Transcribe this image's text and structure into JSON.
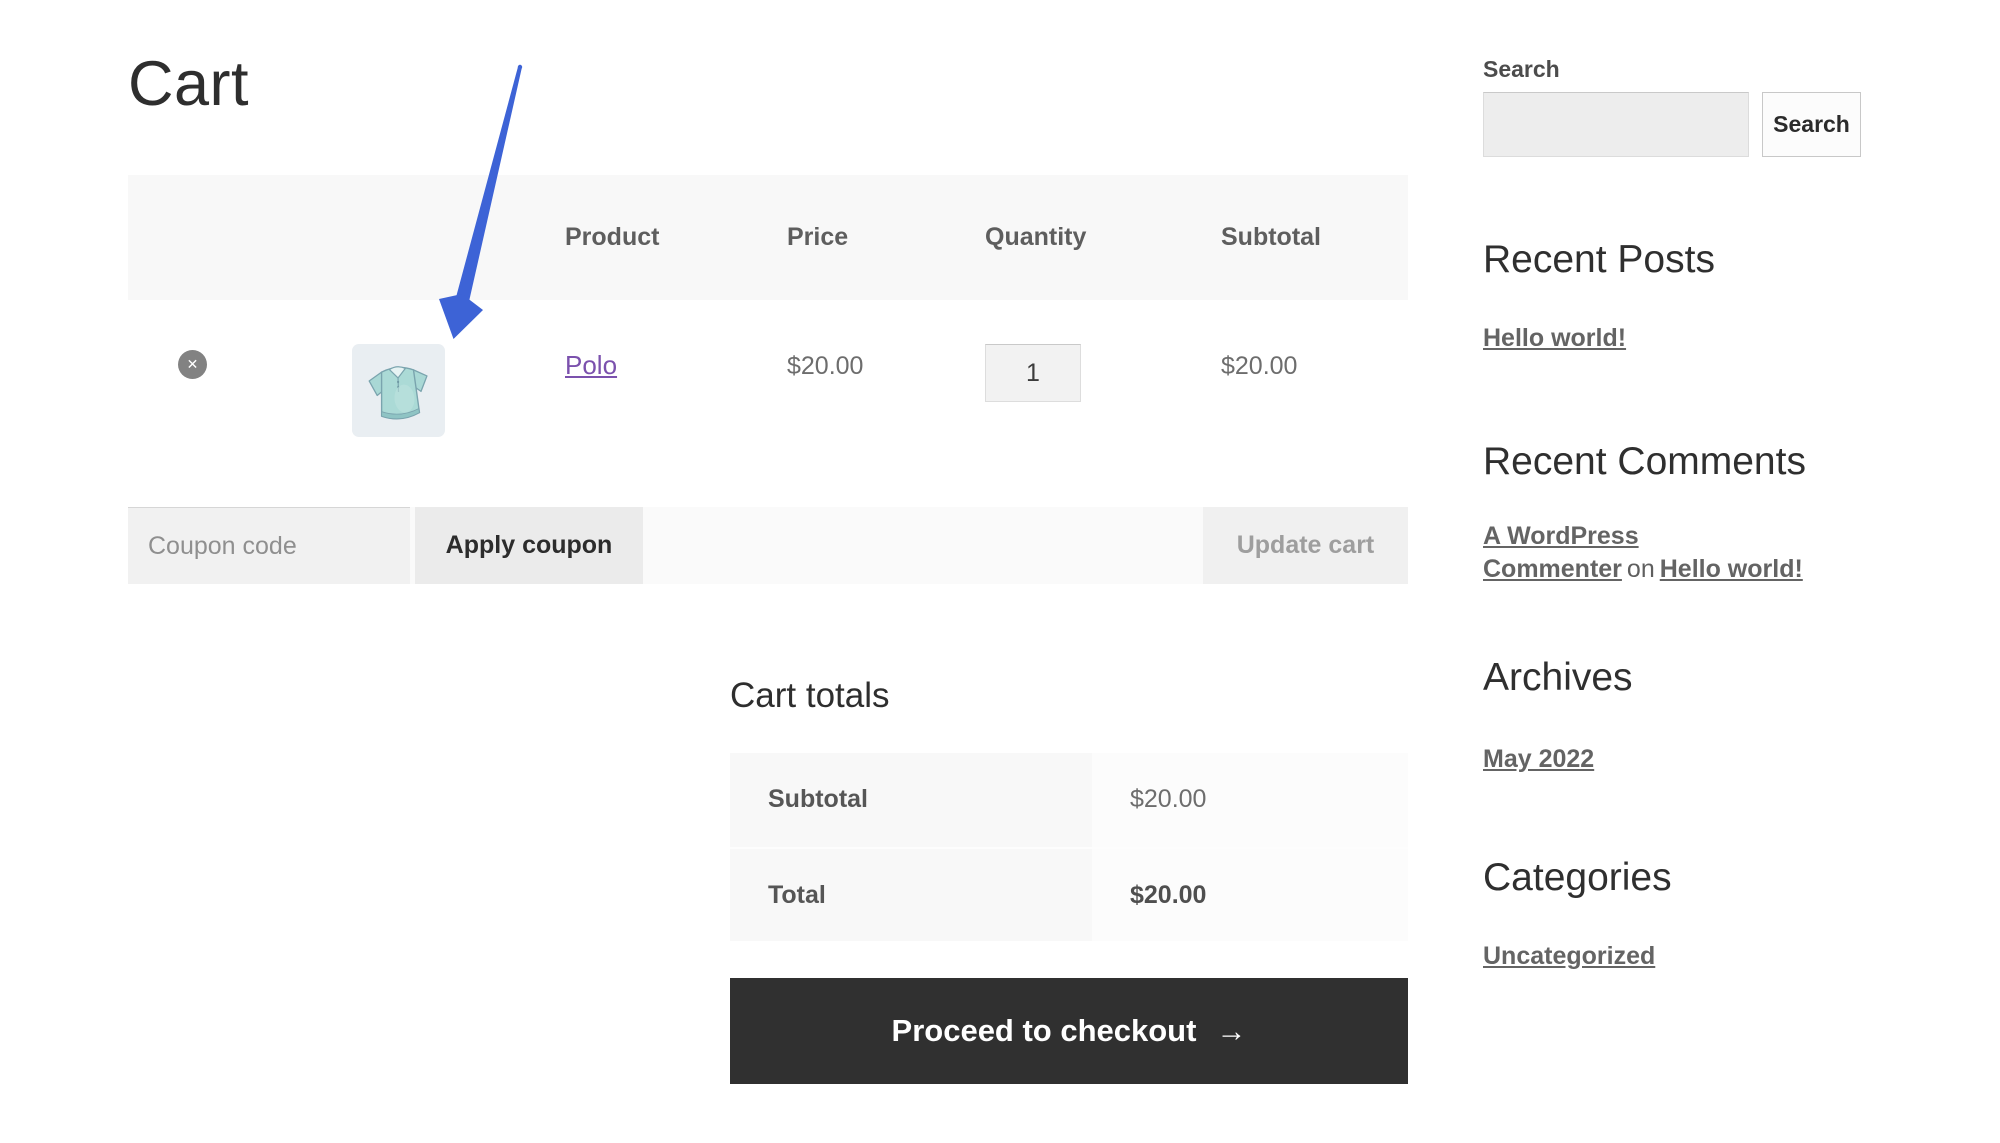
{
  "page": {
    "title": "Cart"
  },
  "cart_table": {
    "headers": {
      "product": "Product",
      "price": "Price",
      "quantity": "Quantity",
      "subtotal": "Subtotal"
    },
    "item": {
      "name": "Polo",
      "price": "$20.00",
      "quantity": "1",
      "subtotal": "$20.00",
      "remove_glyph": "✕",
      "thumbnail_icon": "polo-shirt-illustration"
    }
  },
  "coupon_row": {
    "coupon_placeholder": "Coupon code",
    "apply_button": "Apply coupon",
    "update_button": "Update cart"
  },
  "cart_totals": {
    "title": "Cart totals",
    "subtotal_label": "Subtotal",
    "subtotal_value": "$20.00",
    "total_label": "Total",
    "total_value": "$20.00"
  },
  "checkout": {
    "label": "Proceed to checkout",
    "arrow_glyph": "→"
  },
  "sidebar": {
    "search": {
      "title": "Search",
      "button": "Search"
    },
    "recent_posts": {
      "title": "Recent Posts",
      "post_link": "Hello world!"
    },
    "recent_comments": {
      "title": "Recent Comments",
      "author_link": "A WordPress Commenter",
      "connector": "on",
      "post_link": "Hello world!"
    },
    "archives": {
      "title": "Archives",
      "link": "May 2022"
    },
    "categories": {
      "title": "Categories",
      "link": "Uncategorized"
    }
  },
  "colors": {
    "link_purple": "#7b51ad",
    "annotation_arrow_blue": "#3d63d6",
    "checkout_button_bg": "#303030",
    "table_header_bg": "#f8f8f8"
  }
}
